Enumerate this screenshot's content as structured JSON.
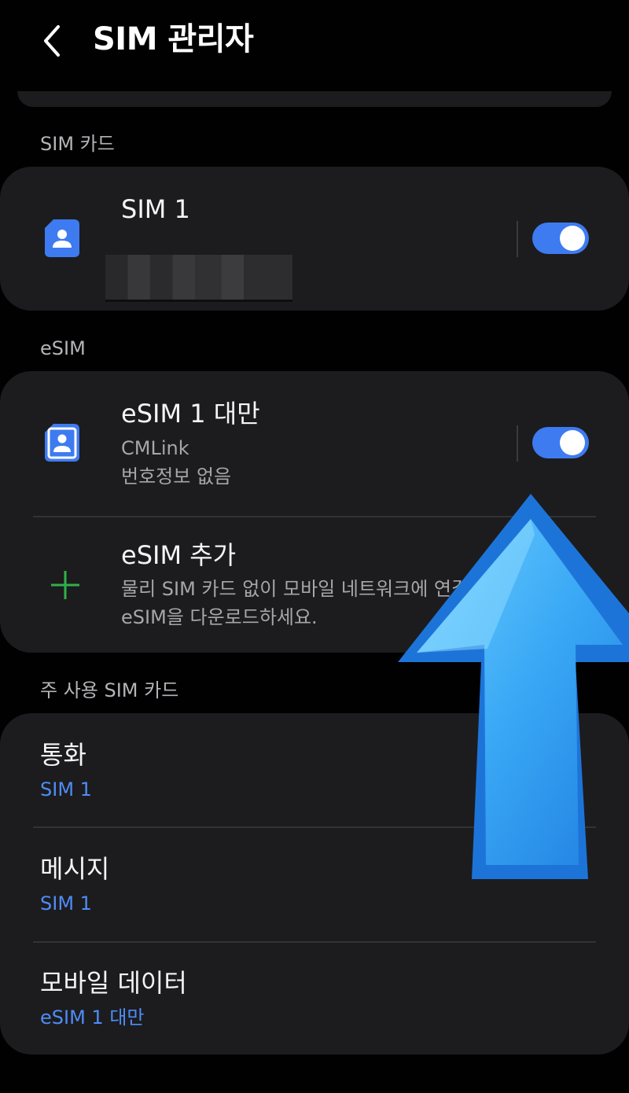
{
  "header": {
    "back_icon": "chevron-left-icon",
    "title": "SIM 관리자"
  },
  "sections": {
    "sim_cards": "SIM 카드",
    "esim": "eSIM",
    "primary_sim": "주 사용 SIM 카드"
  },
  "sim1": {
    "title": "SIM 1",
    "number_hidden": "",
    "enabled": true,
    "icon": "sim-card-icon"
  },
  "esim1": {
    "title": "eSIM 1 대만",
    "carrier": "CMLink",
    "number_status": "번호정보 없음",
    "enabled": true,
    "icon": "sim-card-icon"
  },
  "add_esim": {
    "title": "eSIM 추가",
    "description_line1": "물리 SIM 카드 없이 모바일 네트워크에 연결하려면",
    "description_line2": "eSIM을 다운로드하세요.",
    "icon": "plus-icon"
  },
  "preferences": [
    {
      "label": "통화",
      "value": "SIM 1"
    },
    {
      "label": "메시지",
      "value": "SIM 1"
    },
    {
      "label": "모바일 데이터",
      "value": "eSIM 1 대만"
    }
  ],
  "colors": {
    "background": "#010101",
    "card": "#1c1c1e",
    "accent": "#3e7bf1",
    "link_value": "#4f8cf7",
    "plus_green": "#2fb14a",
    "arrow": "#3aa8f5"
  }
}
